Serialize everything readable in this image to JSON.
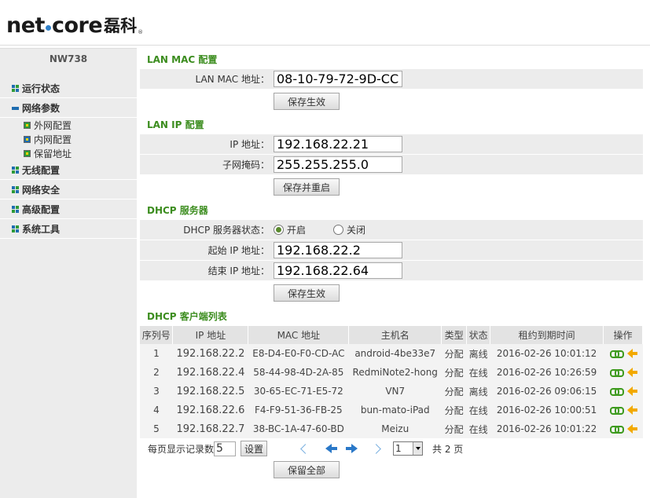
{
  "brand": {
    "logo_left": "net",
    "logo_right": "core",
    "logo_cn": "磊科",
    "reg_mark": "®"
  },
  "sidebar": {
    "model": "NW738",
    "menu": [
      {
        "label": "运行状态",
        "icon": "grid-icon"
      },
      {
        "label": "网络参数",
        "icon": "minus-icon"
      },
      {
        "label": "无线配置",
        "icon": "grid-icon"
      },
      {
        "label": "网络安全",
        "icon": "grid-icon"
      },
      {
        "label": "高级配置",
        "icon": "grid-icon"
      },
      {
        "label": "系统工具",
        "icon": "grid-icon"
      }
    ],
    "submenu": [
      {
        "label": "外网配置"
      },
      {
        "label": "内网配置",
        "current": true
      },
      {
        "label": "保留地址"
      }
    ]
  },
  "lan_mac": {
    "title": "LAN MAC 配置",
    "mac_label": "LAN MAC 地址：",
    "mac_value": "08-10-79-72-9D-CC",
    "save_button": "保存生效"
  },
  "lan_ip": {
    "title": "LAN IP 配置",
    "ip_label": "IP 地址：",
    "ip_value": "192.168.22.21",
    "mask_label": "子网掩码：",
    "mask_value": "255.255.255.0",
    "save_button": "保存并重启"
  },
  "dhcp": {
    "title": "DHCP 服务器",
    "status_label": "DHCP 服务器状态：",
    "option_on": "开启",
    "option_off": "关闭",
    "selected": "开启",
    "start_label": "起始 IP 地址：",
    "start_value": "192.168.22.2",
    "end_label": "结束 IP 地址：",
    "end_value": "192.168.22.64",
    "save_button": "保存生效"
  },
  "clients": {
    "title": "DHCP 客户端列表",
    "columns": [
      "序列号",
      "IP 地址",
      "MAC 地址",
      "主机名",
      "类型",
      "状态",
      "租约到期时间",
      "操作"
    ],
    "rows": [
      [
        "1",
        "192.168.22.2",
        "E8-D4-E0-F0-CD-AC",
        "android-4be33e7",
        "分配",
        "离线",
        "2016-02-26 10:01:12"
      ],
      [
        "2",
        "192.168.22.4",
        "58-44-98-4D-2A-85",
        "RedmiNote2-hong",
        "分配",
        "在线",
        "2016-02-26 10:26:59"
      ],
      [
        "3",
        "192.168.22.5",
        "30-65-EC-71-E5-72",
        "VN7",
        "分配",
        "离线",
        "2016-02-26 09:06:15"
      ],
      [
        "4",
        "192.168.22.6",
        "F4-F9-51-36-FB-25",
        "bun-mato-iPad",
        "分配",
        "在线",
        "2016-02-26 10:00:51"
      ],
      [
        "5",
        "192.168.22.7",
        "38-BC-1A-47-60-BD",
        "Meizu",
        "分配",
        "在线",
        "2016-02-26 10:01:22"
      ]
    ],
    "per_page_label": "每页显示记录数",
    "per_page_value": "5",
    "set_button": "设置",
    "page_select": "1",
    "total_pages_text": "共 2 页",
    "save_all_button": "保留全部"
  }
}
